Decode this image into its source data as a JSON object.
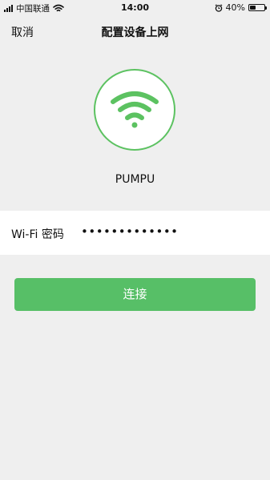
{
  "status_bar": {
    "carrier": "中国联通",
    "time": "14:00",
    "battery_percent": "40%",
    "battery_level": 0.4
  },
  "nav": {
    "cancel_label": "取消",
    "title": "配置设备上网"
  },
  "wifi": {
    "icon": "wifi-icon",
    "ssid": "PUMPU"
  },
  "password": {
    "label": "Wi-Fi 密码",
    "value": "•••••••••••••"
  },
  "actions": {
    "connect_label": "连接"
  },
  "colors": {
    "accent": "#57BF67",
    "ring": "#5CC261",
    "background": "#EFEFEF"
  }
}
